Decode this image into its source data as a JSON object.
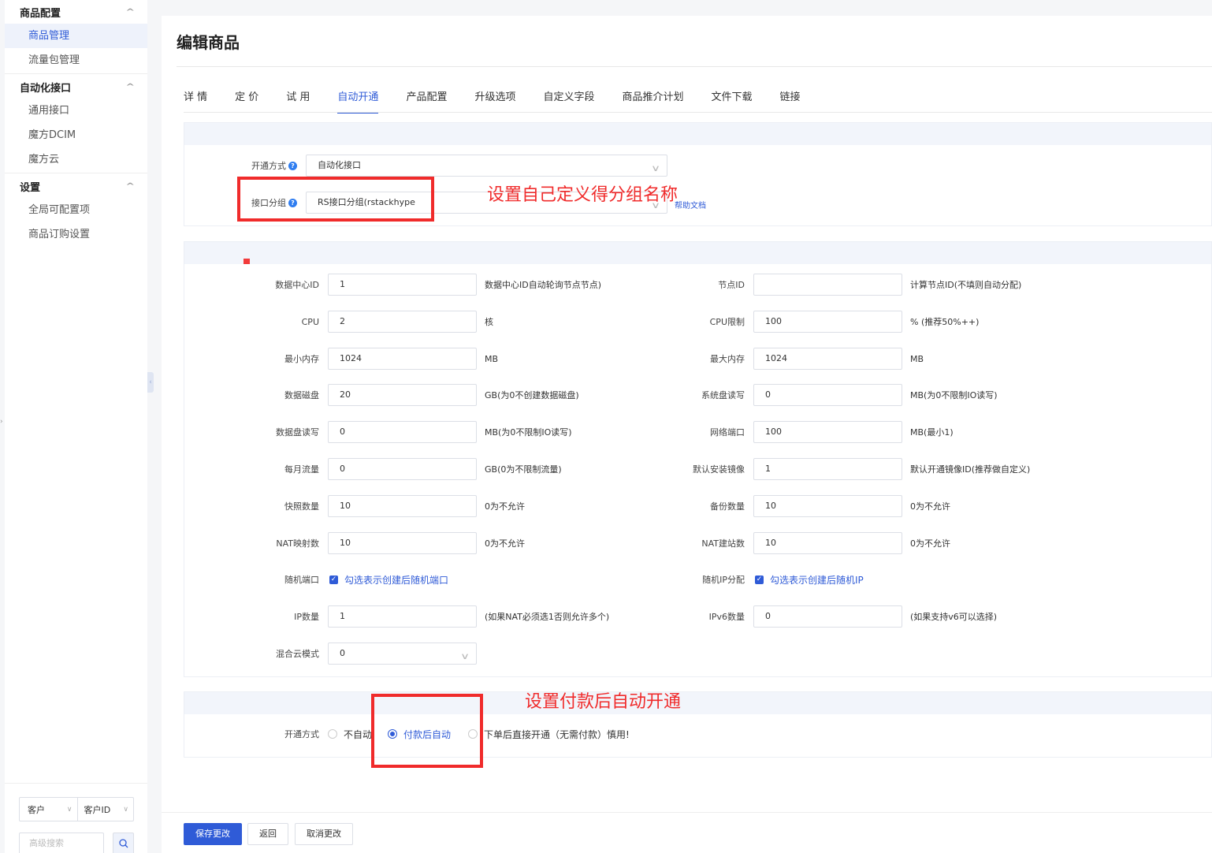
{
  "sidebar": {
    "groups": [
      {
        "label": "商品配置",
        "items": [
          "商品管理",
          "流量包管理"
        ]
      },
      {
        "label": "自动化接口",
        "items": [
          "通用接口",
          "魔方DCIM",
          "魔方云"
        ]
      },
      {
        "label": "设置",
        "items": [
          "全局可配置项",
          "商品订购设置"
        ]
      }
    ],
    "filter": {
      "type_label": "客户",
      "field_label": "客户ID"
    },
    "search_placeholder": "高级搜索"
  },
  "page": {
    "title": "编辑商品"
  },
  "tabs": [
    "详 情",
    "定 价",
    "试 用",
    "自动开通",
    "产品配置",
    "升级选项",
    "自定义字段",
    "商品推介计划",
    "文件下载",
    "链接"
  ],
  "open_panel": {
    "mode_label": "开通方式",
    "mode_value": "自动化接口",
    "group_label": "接口分组",
    "group_value": "RS接口分组(rstackhype",
    "help_link": "帮助文档"
  },
  "config_panel": {
    "left": [
      {
        "label": "数据中心ID",
        "value": "1",
        "hint": "数据中心ID自动轮询节点节点)"
      },
      {
        "label": "CPU",
        "value": "2",
        "hint": "核"
      },
      {
        "label": "最小内存",
        "value": "1024",
        "hint": "MB"
      },
      {
        "label": "数据磁盘",
        "value": "20",
        "hint": "GB(为0不创建数据磁盘)"
      },
      {
        "label": "数据盘读写",
        "value": "0",
        "hint": "MB(为0不限制IO读写)"
      },
      {
        "label": "每月流量",
        "value": "0",
        "hint": "GB(0为不限制流量)"
      },
      {
        "label": "快照数量",
        "value": "10",
        "hint": "0为不允许"
      },
      {
        "label": "NAT映射数",
        "value": "10",
        "hint": "0为不允许"
      },
      {
        "label": "随机端口",
        "checkbox": "勾选表示创建后随机端口"
      },
      {
        "label": "IP数量",
        "value": "1",
        "hint": "(如果NAT必须选1否则允许多个)"
      },
      {
        "label": "混合云模式",
        "value": "0",
        "select": true
      }
    ],
    "right": [
      {
        "label": "节点ID",
        "value": "",
        "hint": "计算节点ID(不填则自动分配)"
      },
      {
        "label": "CPU限制",
        "value": "100",
        "hint": "% (推荐50%++)"
      },
      {
        "label": "最大内存",
        "value": "1024",
        "hint": "MB"
      },
      {
        "label": "系统盘读写",
        "value": "0",
        "hint": "MB(为0不限制IO读写)"
      },
      {
        "label": "网络端口",
        "value": "100",
        "hint": "MB(最小1)"
      },
      {
        "label": "默认安装镜像",
        "value": "1",
        "hint": "默认开通镜像ID(推荐做自定义)"
      },
      {
        "label": "备份数量",
        "value": "10",
        "hint": "0为不允许"
      },
      {
        "label": "NAT建站数",
        "value": "10",
        "hint": "0为不允许"
      },
      {
        "label": "随机IP分配",
        "checkbox": "勾选表示创建后随机IP"
      },
      {
        "label": "IPv6数量",
        "value": "0",
        "hint": "(如果支持v6可以选择)"
      }
    ]
  },
  "activation_panel": {
    "label": "开通方式",
    "options": [
      "不自动",
      "付款后自动",
      "下单后直接开通（无需付款）慎用!"
    ],
    "selected": "付款后自动"
  },
  "annotations": {
    "group_note": "设置自己定义得分组名称",
    "activation_note": "设置付款后自动开通",
    "color": "#f02b2b"
  },
  "buttons": {
    "save": "保存更改",
    "back": "返回",
    "cancel": "取消更改"
  },
  "colors": {
    "accent": "#2f5bd7",
    "panel_head": "#f2f5fb"
  }
}
